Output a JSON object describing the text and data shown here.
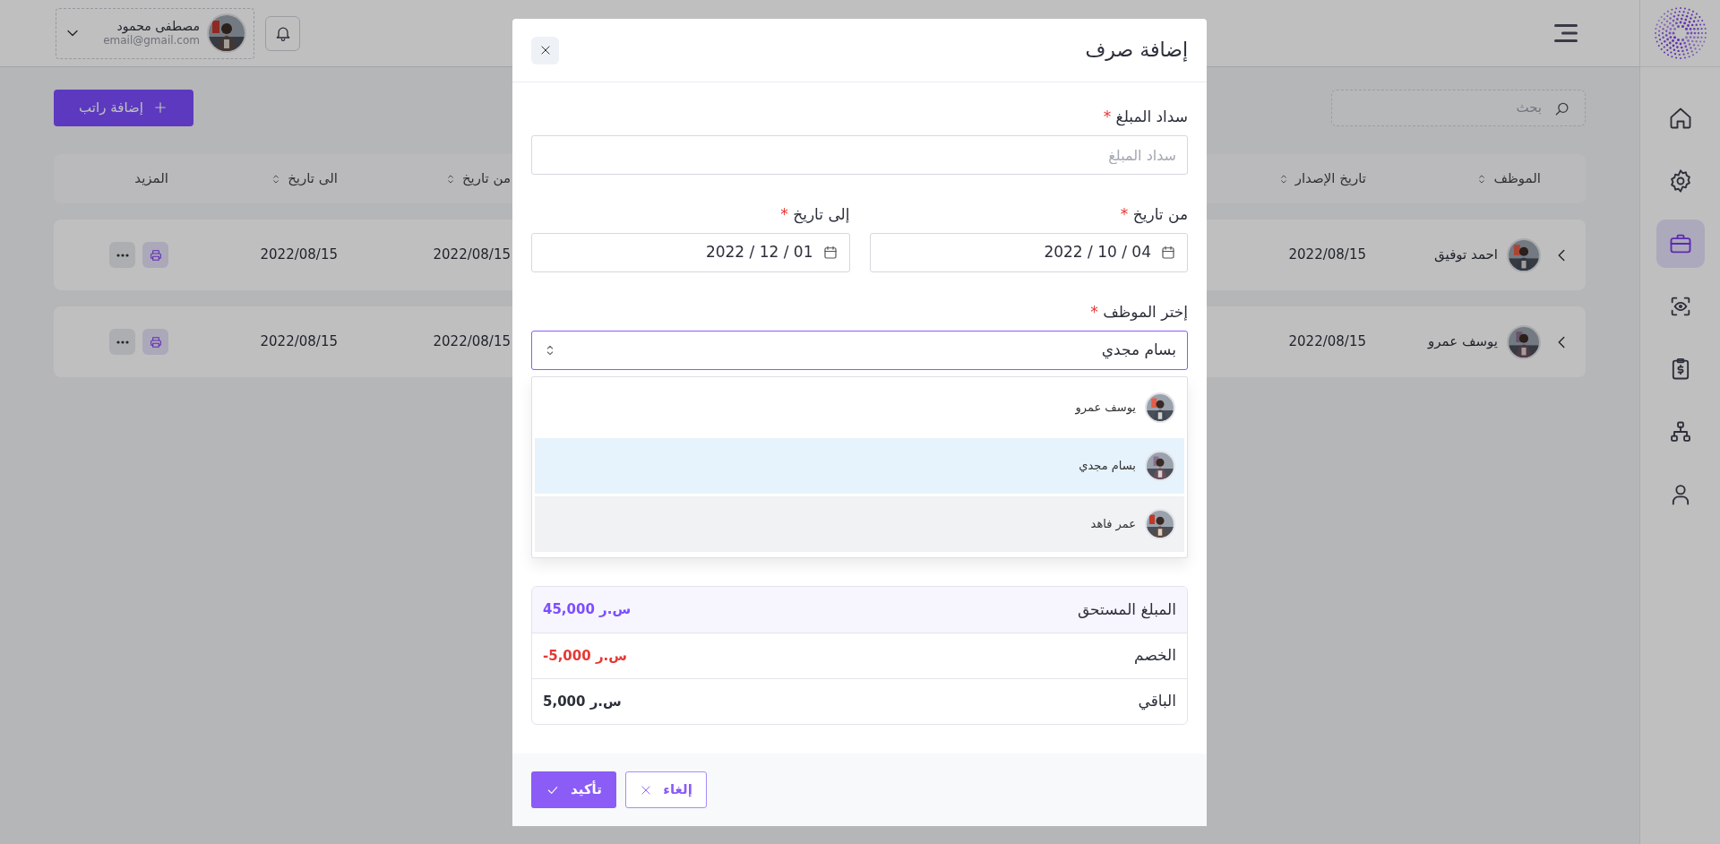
{
  "sidebar": {
    "items": [
      {
        "kind": "home",
        "selected": false
      },
      {
        "kind": "settings",
        "selected": false
      },
      {
        "kind": "briefcase",
        "selected": true
      },
      {
        "kind": "scan",
        "selected": false
      },
      {
        "kind": "invoice",
        "selected": false
      },
      {
        "kind": "hierarchy",
        "selected": false
      },
      {
        "kind": "user",
        "selected": false
      }
    ]
  },
  "header": {
    "user": {
      "name": "مصطفى محمود",
      "email": "email@gmail.com"
    }
  },
  "toolbar": {
    "add_button": "إضافة راتب",
    "search": {
      "placeholder": "بحث"
    }
  },
  "table": {
    "columns": [
      {
        "label": "الموظف",
        "sortable": true
      },
      {
        "label": "تاريخ الإصدار",
        "sortable": true
      },
      {
        "label": "من تاريخ",
        "sortable": true
      },
      {
        "label": "الى تاريخ",
        "sortable": true
      },
      {
        "label": "المزيد",
        "sortable": false
      }
    ],
    "rows": [
      {
        "employee": "احمد توفيق",
        "issue_date": "2022/08/15",
        "from_date": "2022/08/15",
        "to_date": "2022/08/15"
      },
      {
        "employee": "يوسف عمرو",
        "issue_date": "2022/08/15",
        "from_date": "2022/08/15",
        "to_date": "2022/08/15"
      }
    ]
  },
  "modal": {
    "title": "إضافة صرف",
    "fields": [
      {
        "kind": "text",
        "label": "سداد المبلغ",
        "required_mark": "*",
        "placeholder": "سداد المبلغ"
      },
      {
        "kind": "date",
        "label": "من تاريخ",
        "required_mark": "*",
        "value": "2022 / 10 / 04"
      },
      {
        "kind": "date",
        "label": "إلى تاريخ",
        "required_mark": "*",
        "value": "2022 / 12 / 01"
      },
      {
        "kind": "select",
        "label": "إختر الموظف",
        "required_mark": "*",
        "value": "بسام مجدي",
        "options": [
          {
            "label": "يوسف عمرو",
            "selected": false,
            "hovered": false
          },
          {
            "label": "بسام مجدي",
            "selected": true,
            "hovered": false
          },
          {
            "label": "عمر فاهد",
            "selected": false,
            "hovered": true
          }
        ]
      }
    ],
    "summary": [
      {
        "kind": "total",
        "label": "المبلغ المستحق",
        "value": "45,000 س.ر"
      },
      {
        "kind": "deduction",
        "label": "الخصم",
        "value": "-5,000 س.ر"
      },
      {
        "kind": "remaining",
        "label": "الباقي",
        "value": "5,000 س.ر"
      }
    ],
    "buttons": [
      {
        "kind": "cancel",
        "label": "إلغاء"
      },
      {
        "kind": "confirm",
        "label": "تأكيد"
      }
    ]
  }
}
